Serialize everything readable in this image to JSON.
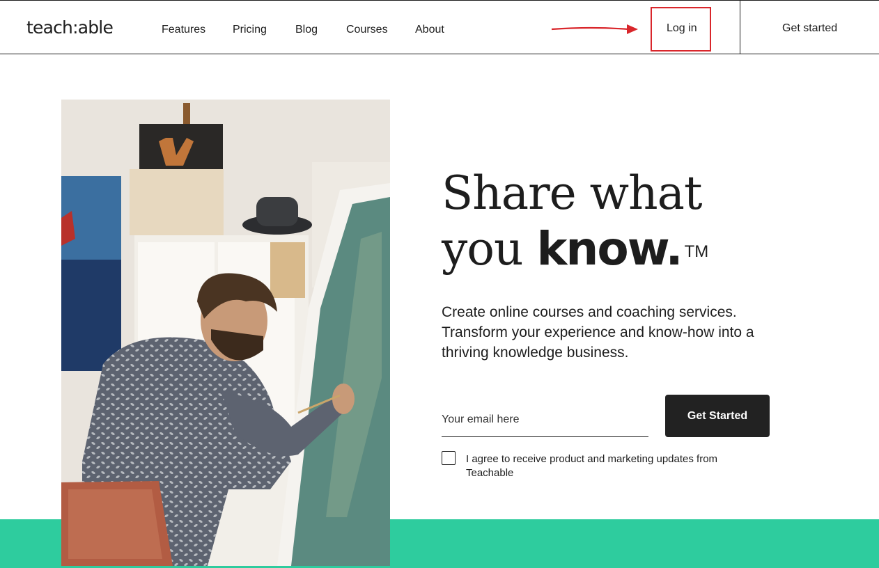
{
  "header": {
    "logo": "teach:able",
    "nav": [
      "Features",
      "Pricing",
      "Blog",
      "Courses",
      "About"
    ],
    "login_label": "Log in",
    "get_started_label": "Get started"
  },
  "hero": {
    "headline_line1": "Share what",
    "headline_line2_light": "you",
    "headline_line2_bold": "know.",
    "trademark": "TM",
    "subtext": "Create online courses and coaching services. Transform your experience and know-how into a thriving knowledge business.",
    "email_placeholder": "Your email here",
    "email_value": "",
    "cta_label": "Get Started",
    "consent_text": "I agree to receive product and marketing updates from Teachable",
    "consent_checked": false
  },
  "colors": {
    "text": "#1d1d1d",
    "accent_green": "#2ecc9e",
    "cta_bg": "#222222",
    "annotation_red": "#d9262b"
  },
  "icons": {
    "annotation": "red-arrow-icon"
  }
}
